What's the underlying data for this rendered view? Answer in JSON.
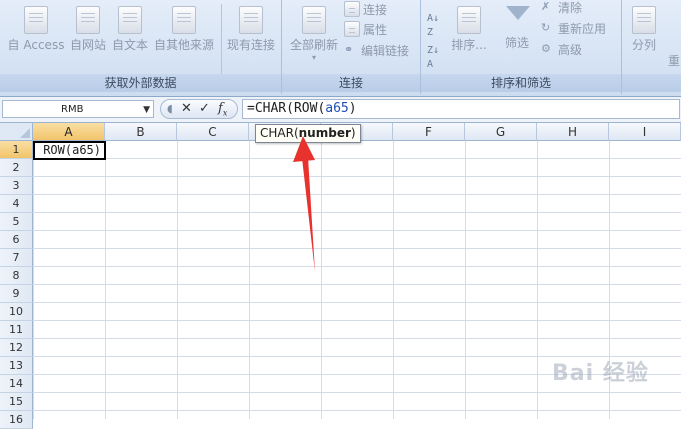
{
  "ribbon": {
    "groups": [
      {
        "label": "获取外部数据",
        "buttons": [
          "自 Access",
          "自网站",
          "自文本",
          "自其他来源",
          "现有连接"
        ]
      },
      {
        "label": "连接",
        "big_button": "全部刷新",
        "items": [
          "连接",
          "属性",
          "编辑链接"
        ]
      },
      {
        "label": "排序和筛选",
        "sort_button": "排序...",
        "filter_button": "筛选",
        "items": [
          "清除",
          "重新应用",
          "高级"
        ]
      },
      {
        "split_button": "分列",
        "partial_text": "重"
      }
    ]
  },
  "formula_bar": {
    "name_box": "RMB",
    "prefix": "=CHAR(ROW(",
    "ref": "a65",
    "suffix": ")"
  },
  "tooltip": {
    "func": "CHAR(",
    "arg": "number",
    "close": ")"
  },
  "grid": {
    "columns": [
      "A",
      "B",
      "C",
      "D",
      "E",
      "F",
      "G",
      "H",
      "I"
    ],
    "rows": [
      "1",
      "2",
      "3",
      "4",
      "5",
      "6",
      "7",
      "8",
      "9",
      "10",
      "11",
      "12",
      "13",
      "14",
      "15",
      "16"
    ],
    "active_cell_text": "ROW(a65)"
  },
  "watermark": "Bai 经验",
  "colors": {
    "arrow": "#e8322d",
    "ref_text": "#1d4fb3",
    "active_header": "#f2c46a"
  }
}
